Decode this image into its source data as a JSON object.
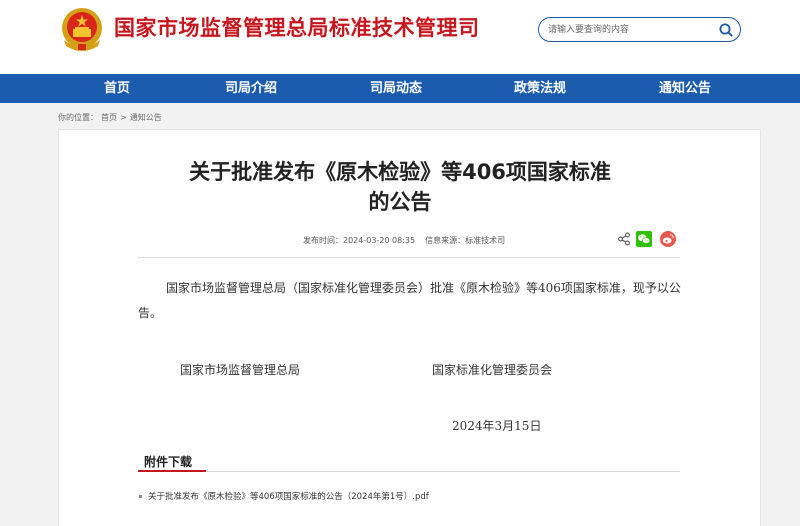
{
  "header": {
    "site_title": "国家市场监督管理总局标准技术管理司",
    "search": {
      "placeholder": "请输入要查询的内容"
    }
  },
  "nav": {
    "items": [
      "首页",
      "司局介绍",
      "司局动态",
      "政策法规",
      "通知公告"
    ]
  },
  "breadcrumb": {
    "prefix": "你的位置：",
    "home": "首页",
    "separator": ">",
    "current": "通知公告"
  },
  "article": {
    "title_line1": "关于批准发布《原木检验》等406项国家标准",
    "title_line2": "的公告",
    "publish_label": "发布时间：",
    "publish_time": "2024-03-20 08:35",
    "source_label": "信息来源：",
    "source": "标准技术司",
    "paragraph": "国家市场监督管理总局（国家标准化管理委员会）批准《原木检验》等406项国家标准，现予以公告。",
    "signer_left": "国家市场监督管理总局",
    "signer_right": "国家标准化管理委员会",
    "date": "2024年3月15日"
  },
  "attachments": {
    "heading": "附件下载",
    "items": [
      "关于批准发布《原木检验》等406项国家标准的公告（2024年第1号）.pdf"
    ]
  },
  "colors": {
    "brand_red": "#c8161e",
    "nav_blue": "#1c5cae",
    "wechat_green": "#2dc100",
    "weibo_red": "#e6594c"
  },
  "icons": [
    "national-emblem-icon",
    "search-icon",
    "share-icon",
    "wechat-icon",
    "weibo-icon"
  ]
}
